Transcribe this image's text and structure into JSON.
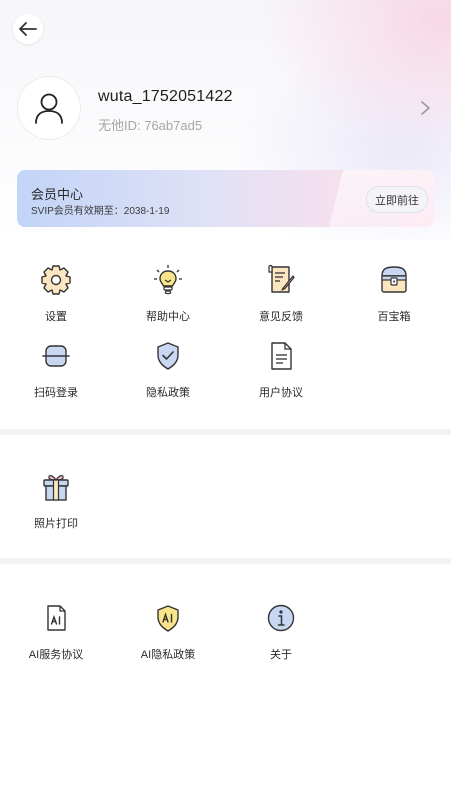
{
  "profile": {
    "username": "wuta_1752051422",
    "user_id": "无他ID: 76ab7ad5"
  },
  "vip": {
    "title": "会员中心",
    "subtitle": "SVIP会员有效期至：2038-1-19",
    "button_label": "立即前往"
  },
  "section1": {
    "items": [
      {
        "label": "设置",
        "icon": "gear-icon"
      },
      {
        "label": "帮助中心",
        "icon": "lightbulb-icon"
      },
      {
        "label": "意见反馈",
        "icon": "feedback-icon"
      },
      {
        "label": "百宝箱",
        "icon": "treasure-chest-icon"
      },
      {
        "label": "扫码登录",
        "icon": "scan-icon"
      },
      {
        "label": "隐私政策",
        "icon": "shield-check-icon"
      },
      {
        "label": "用户协议",
        "icon": "document-icon"
      }
    ]
  },
  "section2": {
    "items": [
      {
        "label": "照片打印",
        "icon": "gift-box-icon"
      }
    ]
  },
  "section3": {
    "items": [
      {
        "label": "AI服务协议",
        "icon": "ai-document-icon"
      },
      {
        "label": "AI隐私政策",
        "icon": "ai-shield-icon"
      },
      {
        "label": "关于",
        "icon": "info-icon"
      }
    ]
  },
  "colors": {
    "icon_cream": "#fbe6bf",
    "icon_yellow": "#fbe58a",
    "icon_blue": "#c8d8f2",
    "icon_stroke": "#333333"
  }
}
